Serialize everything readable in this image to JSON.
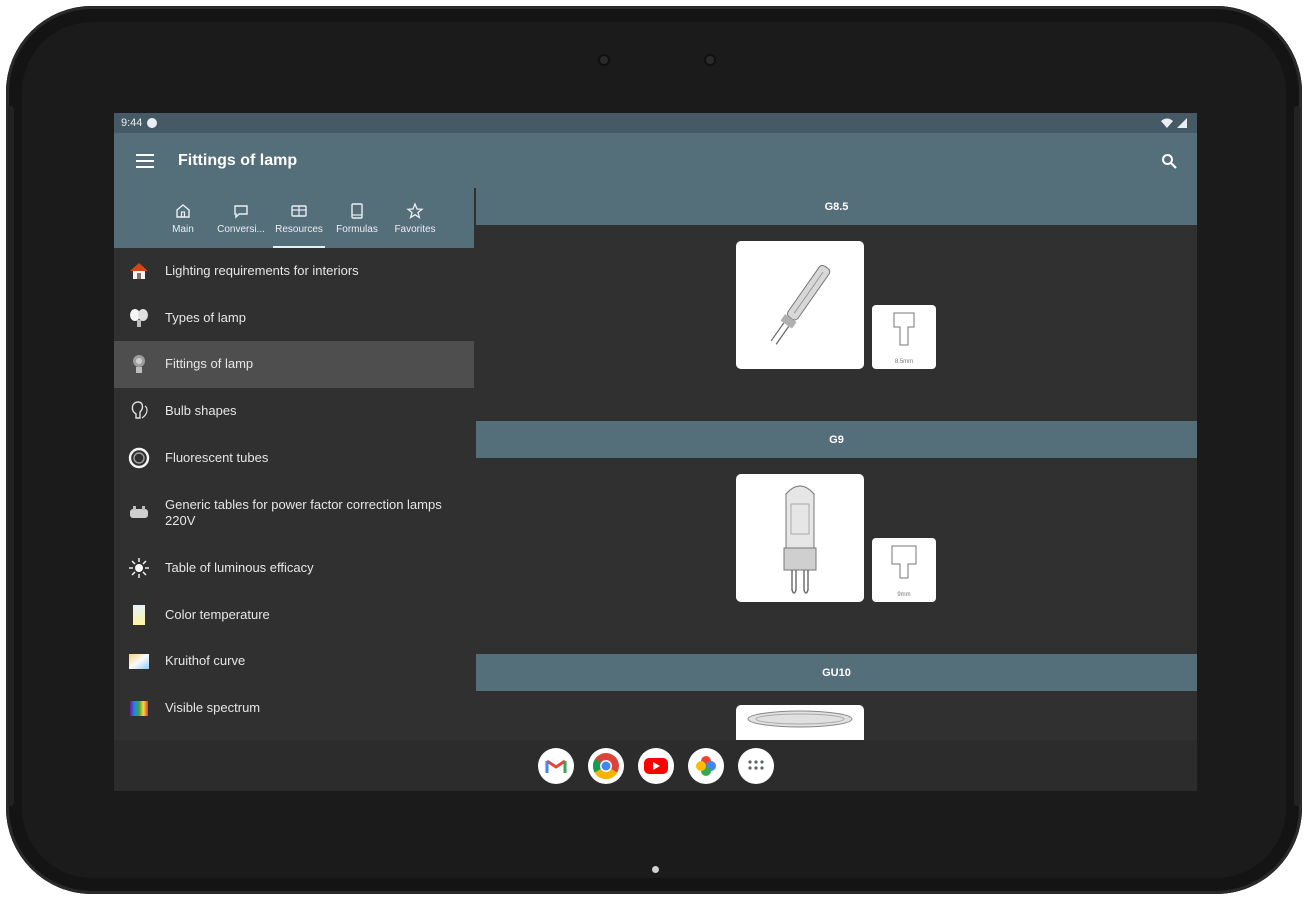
{
  "status_bar": {
    "time": "9:44"
  },
  "app_bar": {
    "title": "Fittings of lamp"
  },
  "tabs": [
    {
      "label": "Main",
      "icon": "home-icon"
    },
    {
      "label": "Conversi...",
      "icon": "conversion-icon"
    },
    {
      "label": "Resources",
      "icon": "resources-icon",
      "active": true
    },
    {
      "label": "Formulas",
      "icon": "formulas-icon"
    },
    {
      "label": "Favorites",
      "icon": "star-icon"
    }
  ],
  "menu_items": [
    {
      "label": "Lighting requirements for interiors",
      "icon": "house-icon"
    },
    {
      "label": "Types of lamp",
      "icon": "lamps-icon"
    },
    {
      "label": "Fittings of lamp",
      "icon": "bulb-fitting-icon",
      "selected": true
    },
    {
      "label": "Bulb shapes",
      "icon": "bulb-shapes-icon"
    },
    {
      "label": "Fluorescent tubes",
      "icon": "fluorescent-tube-icon"
    },
    {
      "label": "Generic tables for power factor correction lamps 220V",
      "icon": "capacitor-icon"
    },
    {
      "label": "Table of luminous efficacy",
      "icon": "sun-icon"
    },
    {
      "label": "Color temperature",
      "icon": "color-temperature-icon"
    },
    {
      "label": "Kruithof curve",
      "icon": "kruithof-curve-icon"
    },
    {
      "label": "Visible spectrum",
      "icon": "spectrum-icon"
    }
  ],
  "sections": [
    {
      "title": "G8.5",
      "small_caption": "8.5mm"
    },
    {
      "title": "G9",
      "small_caption": "9mm"
    },
    {
      "title": "GU10",
      "small_caption": ""
    }
  ],
  "dock": [
    "Gmail",
    "Chrome",
    "YouTube",
    "Photos",
    "Apps"
  ],
  "colors": {
    "app_bar": "#546e7a",
    "status_bar": "#455a64",
    "background": "#303030",
    "selected_item": "#4e4e4e"
  }
}
